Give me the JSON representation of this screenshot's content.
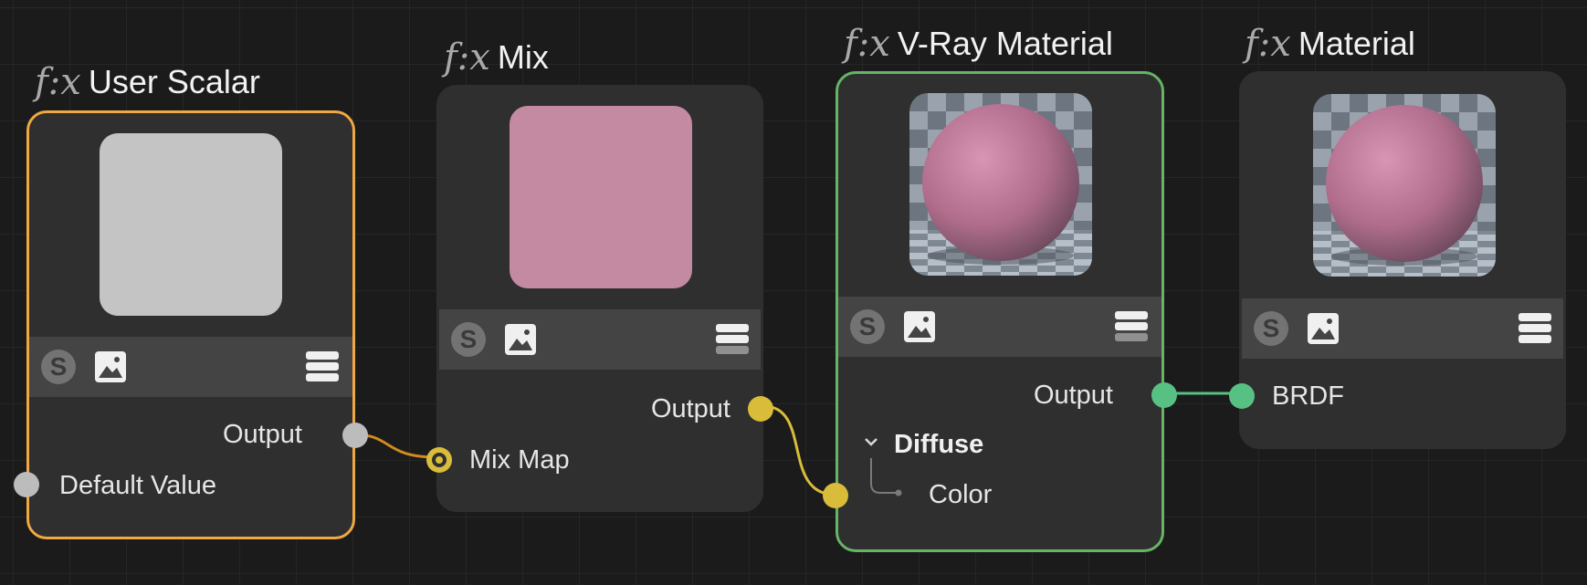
{
  "nodes": {
    "user_scalar": {
      "fx": "f:x",
      "title": "User Scalar",
      "output_label": "Output",
      "input_label": "Default Value"
    },
    "mix": {
      "fx": "f:x",
      "title": "Mix",
      "output_label": "Output",
      "input_label": "Mix Map"
    },
    "vray_material": {
      "fx": "f:x",
      "title": "V-Ray Material",
      "output_label": "Output",
      "group_label": "Diffuse",
      "input_label": "Color"
    },
    "material": {
      "fx": "f:x",
      "title": "Material",
      "input_label": "BRDF"
    }
  },
  "toolbar_icons": [
    "s-icon",
    "image-icon",
    "menu-icon"
  ],
  "colors": {
    "selection_orange": "#f0a842",
    "selection_green": "#66b466",
    "wire_orange": "#d08a1e",
    "wire_yellow": "#d9bd3a",
    "wire_green": "#57c184",
    "port_grey": "#bcbcbc",
    "preview_grey": "#c4c4c4",
    "preview_pink": "#c48aa2"
  }
}
